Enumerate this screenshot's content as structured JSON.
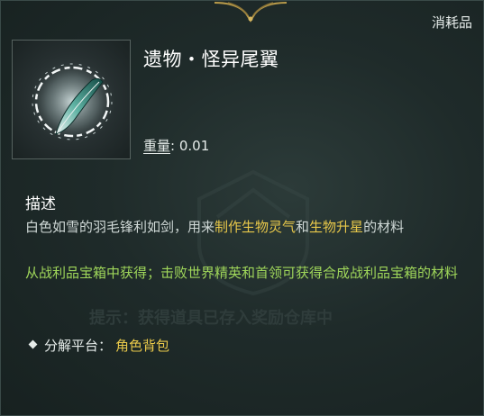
{
  "item": {
    "category": "消耗品",
    "title": "遗物・怪异尾翼",
    "weight_label": "重量",
    "weight_sep": ":",
    "weight_value": "0.01",
    "icon": "feather-relic-icon"
  },
  "description": {
    "heading": "描述",
    "text_part1": "白色如雪的羽毛锋利如剑，用来",
    "highlight1": "制作生物灵气",
    "text_part2": "和",
    "highlight2": "生物升星",
    "text_part3": "的材料"
  },
  "source": {
    "text": "从战利品宝箱中获得；击败世界精英和首领可获得合成战利品宝箱的材料"
  },
  "watermark": {
    "text": "提示：获得道具已存入奖励仓库中"
  },
  "dismantle": {
    "label": "分解平台：",
    "value": "角色背包"
  },
  "colors": {
    "highlight": "#e8c84a",
    "source_text": "#9fd65a",
    "background": "#1f2b2a"
  }
}
